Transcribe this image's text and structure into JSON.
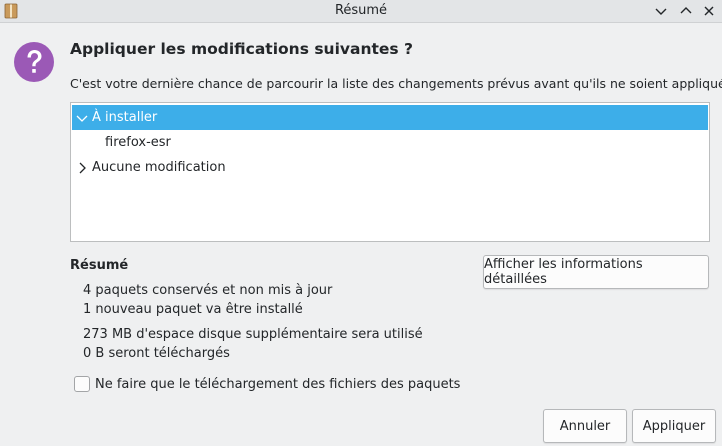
{
  "window": {
    "title": "Résumé",
    "icon": "package-icon"
  },
  "dialog": {
    "icon": "question-icon",
    "heading": "Appliquer les modifications suivantes ?",
    "description": "C'est votre dernière chance de parcourir la liste des changements prévus avant qu'ils ne soient appliqués."
  },
  "tree": {
    "groups": [
      {
        "label": "À installer",
        "expanded": true,
        "selected": true,
        "children": [
          "firefox-esr"
        ]
      },
      {
        "label": "Aucune modification",
        "expanded": false,
        "selected": false,
        "children": []
      }
    ]
  },
  "summary": {
    "title": "Résumé",
    "lines": [
      "4 paquets conservés et non mis à jour",
      "1 nouveau paquet va être installé",
      "273 MB d'espace disque supplémentaire sera utilisé",
      "0  B seront téléchargés"
    ],
    "details_button": "Afficher les informations détaillées"
  },
  "options": {
    "download_only_label": "Ne faire que le téléchargement des fichiers des paquets",
    "download_only_checked": false
  },
  "buttons": {
    "cancel": "Annuler",
    "apply": "Appliquer"
  },
  "colors": {
    "selection": "#3daee9",
    "question_icon": "#9b59b6"
  }
}
